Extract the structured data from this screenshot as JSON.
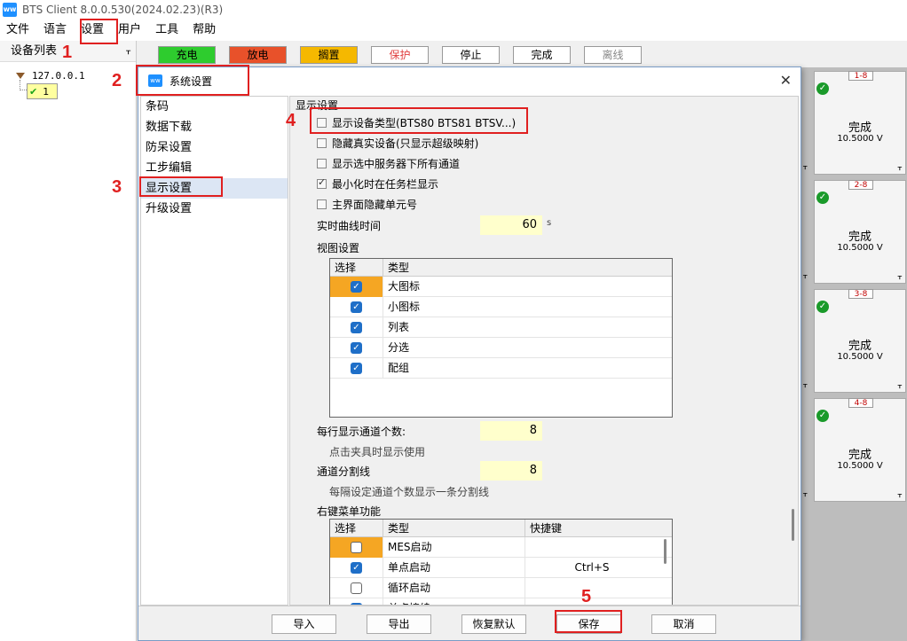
{
  "app": {
    "title": "BTS Client 8.0.0.530(2024.02.23)(R3)",
    "logo_text": "ww"
  },
  "menu": [
    "文件",
    "语言",
    "设置",
    "用户",
    "工具",
    "帮助"
  ],
  "device_list": {
    "title": "设备列表",
    "root": "127.0.0.1",
    "child": "1"
  },
  "toolbar": {
    "buttons": [
      {
        "label": "充电",
        "color": "#2ecc2e"
      },
      {
        "label": "放电",
        "color": "#e8512a"
      },
      {
        "label": "搁置",
        "color": "#f5b800"
      },
      {
        "label": "保护",
        "color": "#ffffff"
      },
      {
        "label": "停止",
        "color": "#ffffff"
      },
      {
        "label": "完成",
        "color": "#ffffff"
      },
      {
        "label": "离线",
        "color": "#ffffff"
      }
    ]
  },
  "channels": [
    {
      "tag": "1-8",
      "status": "完成",
      "voltage": "10.5000 V"
    },
    {
      "tag": "2-8",
      "status": "完成",
      "voltage": "10.5000 V"
    },
    {
      "tag": "3-8",
      "status": "完成",
      "voltage": "10.5000 V"
    },
    {
      "tag": "4-8",
      "status": "完成",
      "voltage": "10.5000 V"
    }
  ],
  "dialog": {
    "title": "系统设置",
    "nav": [
      "条码",
      "数据下载",
      "防呆设置",
      "工步编辑",
      "显示设置",
      "升级设置"
    ],
    "section_title": "显示设置",
    "options": [
      {
        "label": "显示设备类型(BTS80 BTS81 BTSV...)",
        "checked": false
      },
      {
        "label": "隐藏真实设备(只显示超级映射)",
        "checked": false
      },
      {
        "label": "显示选中服务器下所有通道",
        "checked": false
      },
      {
        "label": "最小化时在任务栏显示",
        "checked": true
      },
      {
        "label": "主界面隐藏单元号",
        "checked": false
      }
    ],
    "realtime_curve_label": "实时曲线时间",
    "realtime_curve_value": "60",
    "realtime_curve_unit": "s",
    "view_settings_title": "视图设置",
    "view_table": {
      "headers": [
        "选择",
        "类型"
      ],
      "rows": [
        {
          "type": "大图标",
          "checked": true
        },
        {
          "type": "小图标",
          "checked": true
        },
        {
          "type": "列表",
          "checked": true
        },
        {
          "type": "分选",
          "checked": true
        },
        {
          "type": "配组",
          "checked": true
        }
      ]
    },
    "per_row_label": "每行显示通道个数:",
    "per_row_value": "8",
    "per_row_hint": "点击夹具时显示使用",
    "divider_label": "通道分割线",
    "divider_value": "8",
    "divider_hint": "每隔设定通道个数显示一条分割线",
    "context_menu_title": "右键菜单功能",
    "context_table": {
      "headers": [
        "选择",
        "类型",
        "快捷键"
      ],
      "rows": [
        {
          "type": "MES启动",
          "checked": false,
          "key": ""
        },
        {
          "type": "单点启动",
          "checked": true,
          "key": "Ctrl+S"
        },
        {
          "type": "循环启动",
          "checked": false,
          "key": ""
        },
        {
          "type": "单点接续",
          "checked": true,
          "key": ""
        }
      ]
    },
    "footer": [
      "导入",
      "导出",
      "恢复默认",
      "保存",
      "取消"
    ]
  },
  "annotations": [
    "1",
    "2",
    "3",
    "4",
    "5"
  ]
}
